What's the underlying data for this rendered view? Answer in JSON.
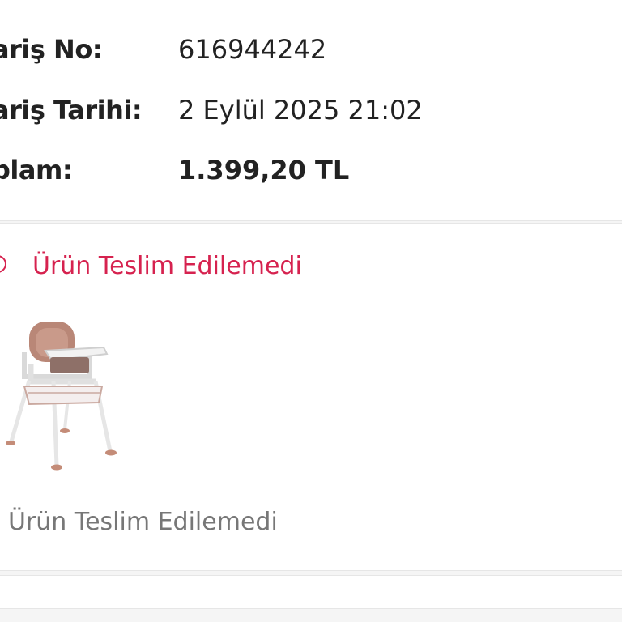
{
  "order": {
    "number_label": "ariş No:",
    "number_value": "616944242",
    "date_label": "ariş Tarihi:",
    "date_value": "2 Eylül 2025 21:02",
    "total_label": "plam:",
    "total_value": "1.399,20 TL"
  },
  "shipment": {
    "status_text": "Ürün Teslim Edilemedi",
    "status_icon": "alert-circle-icon",
    "status_color": "#d6224f",
    "product_status_text": "Ürün Teslim Edilemedi",
    "product_image": "high-chair-product-image"
  }
}
